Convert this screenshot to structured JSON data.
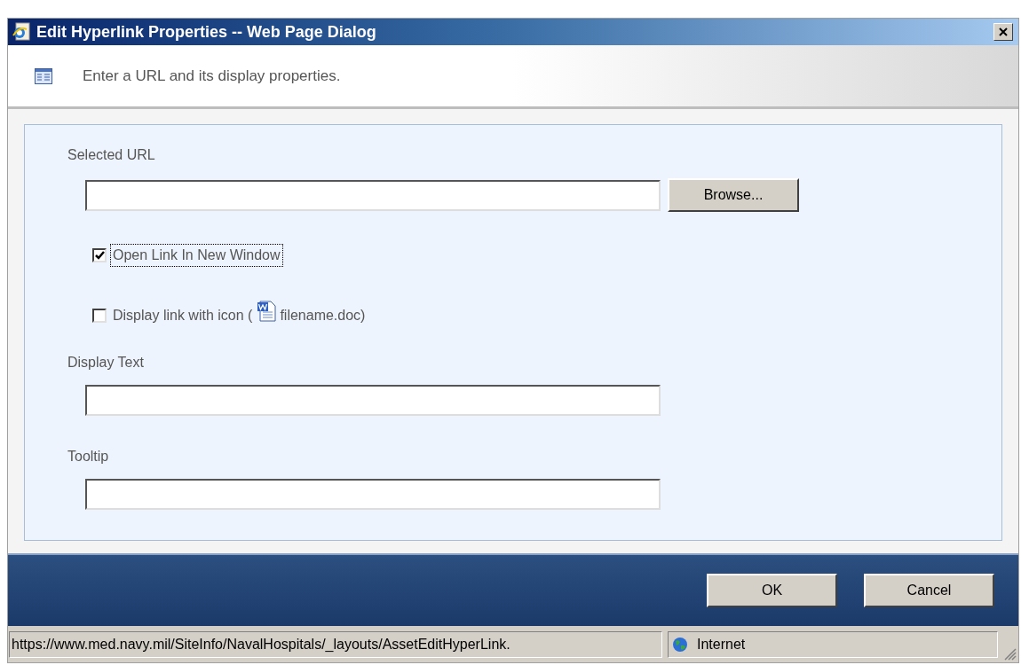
{
  "window": {
    "title": "Edit Hyperlink Properties -- Web Page Dialog"
  },
  "header": {
    "text": "Enter a URL and its display properties."
  },
  "url_section": {
    "label": "Selected URL",
    "browse_button": "Browse..."
  },
  "checkboxes": [
    {
      "label": "Open Link In New Window",
      "checked": true,
      "focused": true
    },
    {
      "label": "Display link with icon (",
      "suffix": "filename.doc)",
      "checked": false,
      "focused": false
    }
  ],
  "fields": [
    {
      "label": "Display Text"
    },
    {
      "label": "Tooltip"
    }
  ],
  "buttons": [
    "OK",
    "Cancel"
  ],
  "status_bar": {
    "url": "https://www.med.navy.mil/SiteInfo/NavalHospitals/_layouts/AssetEditHyperLink.",
    "zone": "Internet"
  }
}
